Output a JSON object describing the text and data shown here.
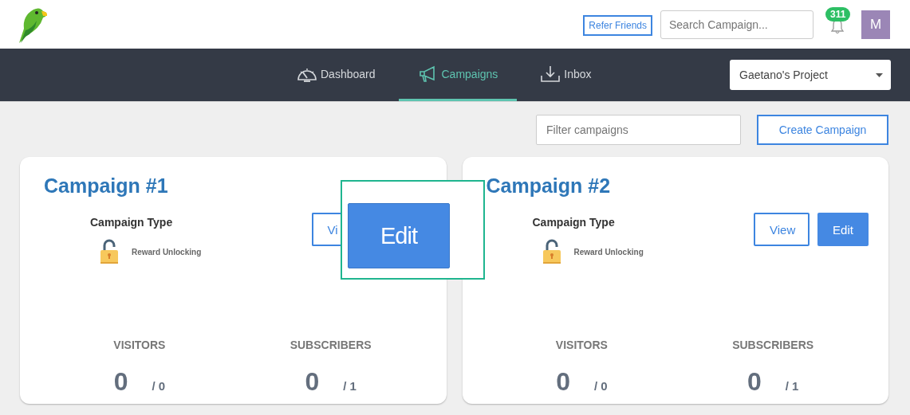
{
  "header": {
    "refer_link": "Refer Friends",
    "search": {
      "placeholder": "Search Campaign..."
    },
    "notification_count": "311",
    "avatar_initial": "M"
  },
  "nav": {
    "tabs": [
      {
        "label": "Dashboard",
        "kind": "gauge",
        "selected": false
      },
      {
        "label": "Campaigns",
        "kind": "megaphone",
        "selected": true
      },
      {
        "label": "Inbox",
        "kind": "download",
        "selected": false
      }
    ],
    "project_select": {
      "value": "Gaetano's Project"
    }
  },
  "toolbar": {
    "filter": {
      "placeholder": "Filter campaigns"
    },
    "create_button": "Create Campaign"
  },
  "campaigns": [
    {
      "title": "Campaign #1",
      "type_label": "Campaign Type",
      "type_value": "Reward Unlocking",
      "buttons": [
        {
          "kind": "outline_cut",
          "label": "Vi"
        }
      ],
      "stats": [
        {
          "label": "VISITORS",
          "value": "0",
          "total": "/ 0"
        },
        {
          "label": "SUBSCRIBERS",
          "value": "0",
          "total": "/ 1"
        }
      ]
    },
    {
      "title": "Campaign #2",
      "type_label": "Campaign Type",
      "type_value": "Reward Unlocking",
      "buttons": [
        {
          "kind": "outline",
          "label": "View"
        },
        {
          "kind": "solid",
          "label": "Edit"
        }
      ],
      "stats": [
        {
          "label": "VISITORS",
          "value": "0",
          "total": "/ 0"
        },
        {
          "label": "SUBSCRIBERS",
          "value": "0",
          "total": "/ 1"
        }
      ]
    }
  ],
  "zoom_preview": {
    "label": "Edit"
  }
}
